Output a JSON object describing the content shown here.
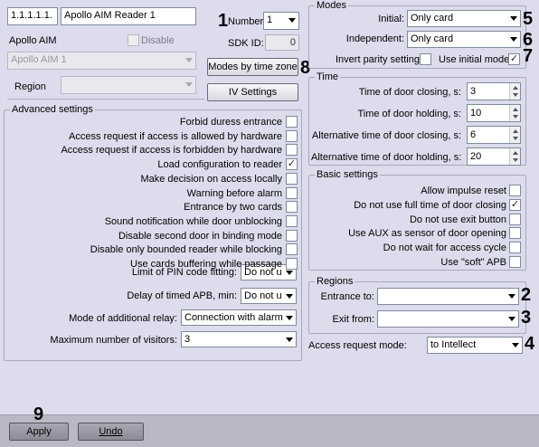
{
  "header": {
    "address": "1.1.1.1.1.",
    "name": "Apollo AIM Reader 1",
    "number_label": "Number:",
    "number_value": "1",
    "sdk_label": "SDK ID:",
    "sdk_value": "0",
    "type_label": "Apollo AIM",
    "disable_label": "Disable",
    "device_combo": "Apollo AIM 1",
    "region_label": "Region",
    "region_value": ""
  },
  "buttons": {
    "modes_by_time_zone": "Modes by time zone",
    "iv_settings": "IV Settings",
    "apply": "Apply",
    "undo": "Undo"
  },
  "advanced": {
    "title": "Advanced settings",
    "checkboxes": [
      {
        "label": "Forbid duress entrance",
        "checked": false
      },
      {
        "label": "Access request if access is allowed by hardware",
        "checked": false
      },
      {
        "label": "Access request if access is forbidden by hardware",
        "checked": false
      },
      {
        "label": "Load configuration to reader",
        "checked": true
      },
      {
        "label": "Make decision on access locally",
        "checked": false
      },
      {
        "label": "Warning before alarm",
        "checked": false
      },
      {
        "label": "Entrance by two cards",
        "checked": false
      },
      {
        "label": "Sound notification while door unblocking",
        "checked": false
      },
      {
        "label": "Disable second door in binding mode",
        "checked": false
      },
      {
        "label": "Disable only bounded reader while blocking",
        "checked": false
      },
      {
        "label": "Use cards buffering while passage",
        "checked": false
      }
    ],
    "pin_label": "Limit of PIN code fitting:",
    "pin_value": "Do not u",
    "apb_label": "Delay of timed APB, min:",
    "apb_value": "Do not u",
    "relay_label": "Mode of additional relay:",
    "relay_value": "Connection with alarm",
    "visitors_label": "Maximum number of visitors:",
    "visitors_value": "3"
  },
  "modes": {
    "title": "Modes",
    "initial_label": "Initial:",
    "initial_value": "Only card",
    "independent_label": "Independent:",
    "independent_value": "Only card",
    "invert_parity_label": "Invert parity setting",
    "invert_parity_checked": false,
    "use_initial_label": "Use initial mode",
    "use_initial_checked": true
  },
  "time": {
    "title": "Time",
    "rows": [
      {
        "label": "Time of door closing, s:",
        "value": "3"
      },
      {
        "label": "Time of door holding, s:",
        "value": "10"
      },
      {
        "label": "Alternative time of door closing, s:",
        "value": "6"
      },
      {
        "label": "Alternative time of door holding, s:",
        "value": "20"
      }
    ]
  },
  "basic": {
    "title": "Basic settings",
    "checkboxes": [
      {
        "label": "Allow impulse reset",
        "checked": false
      },
      {
        "label": "Do not use full time of door closing",
        "checked": true
      },
      {
        "label": "Do not use exit button",
        "checked": false
      },
      {
        "label": "Use AUX as sensor of door opening",
        "checked": false
      },
      {
        "label": "Do not wait for access cycle",
        "checked": false
      },
      {
        "label": "Use \"soft\" APB",
        "checked": false
      }
    ]
  },
  "regions": {
    "title": "Regions",
    "entrance_label": "Entrance to:",
    "entrance_value": "",
    "exit_label": "Exit from:",
    "exit_value": ""
  },
  "access_mode": {
    "label": "Access request mode:",
    "value": "to Intellect"
  },
  "callouts": [
    "1",
    "2",
    "3",
    "4",
    "5",
    "6",
    "7",
    "8",
    "9"
  ],
  "check_mark": "✓"
}
